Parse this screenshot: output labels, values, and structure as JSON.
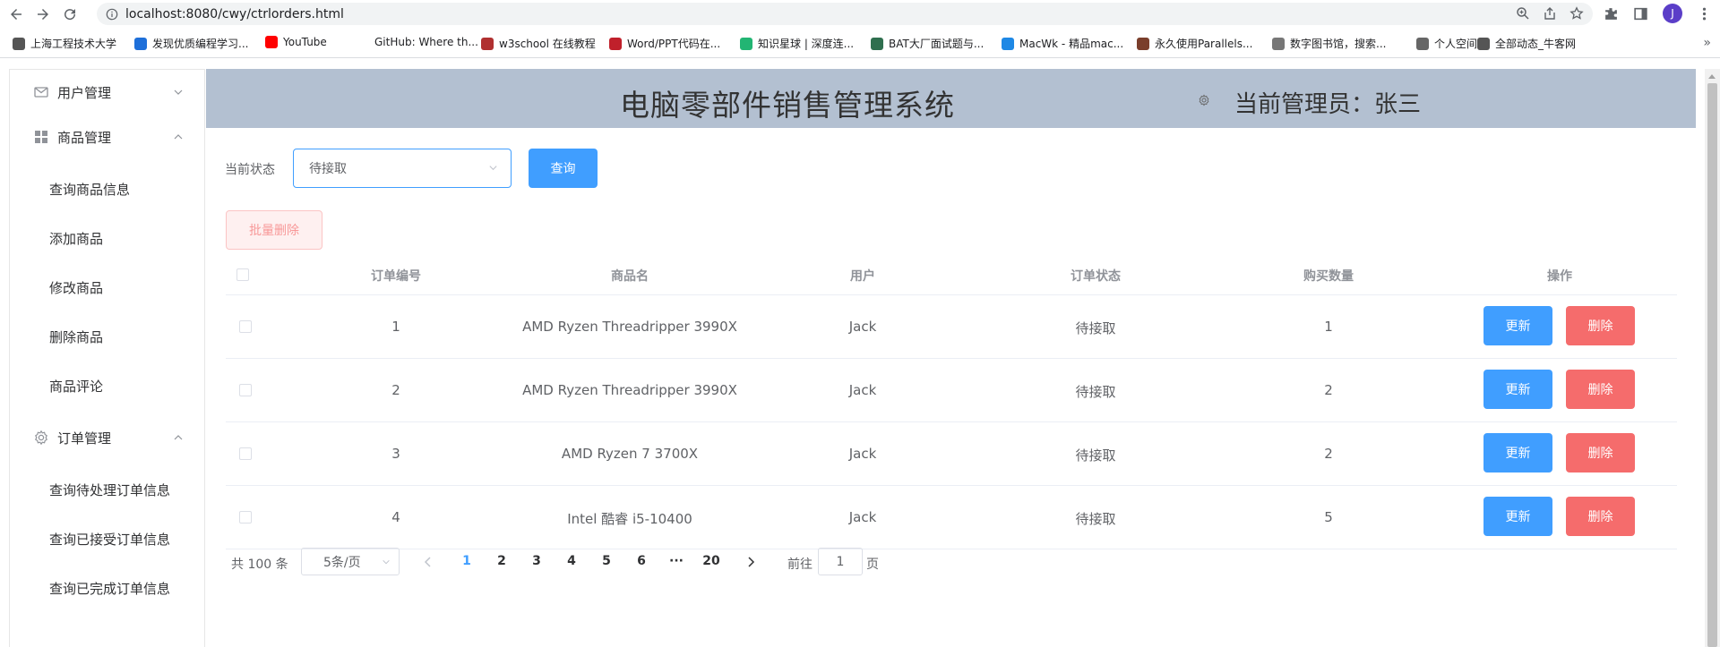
{
  "browser": {
    "url": "localhost:8080/cwy/ctrlorders.html",
    "avatar": "J",
    "bookmarks": [
      {
        "label": "上海工程技术大学",
        "color": "#555"
      },
      {
        "label": "发现优质编程学习...",
        "color": "#1e6fd9"
      },
      {
        "label": "YouTube",
        "color": "#ff0000"
      },
      {
        "label": "GitHub: Where th...",
        "color": "#ffffff"
      },
      {
        "label": "w3school 在线教程",
        "color": "#b03030"
      },
      {
        "label": "Word/PPT代码在...",
        "color": "#c0202b"
      },
      {
        "label": "知识星球 | 深度连...",
        "color": "#22b573"
      },
      {
        "label": "BAT大厂面试题与...",
        "color": "#2f6f4f"
      },
      {
        "label": "MacWk - 精品mac...",
        "color": "#1e88e5"
      },
      {
        "label": "永久使用Parallels...",
        "color": "#7a3e2b"
      },
      {
        "label": "数字图书馆，搜索...",
        "color": "#777"
      },
      {
        "label": "个人空间",
        "color": "#666"
      },
      {
        "label": "全部动态_牛客网",
        "color": "#555"
      }
    ]
  },
  "sidebar": {
    "groups": [
      {
        "label": "用户管理",
        "icon": "envelope-icon",
        "expanded": false
      },
      {
        "label": "商品管理",
        "icon": "grid-icon",
        "expanded": true,
        "items": [
          "查询商品信息",
          "添加商品",
          "修改商品",
          "删除商品",
          "商品评论"
        ]
      },
      {
        "label": "订单管理",
        "icon": "gear-icon",
        "expanded": true,
        "items": [
          "查询待处理订单信息",
          "查询已接受订单信息",
          "查询已完成订单信息"
        ]
      }
    ]
  },
  "header": {
    "title": "电脑零部件销售管理系统",
    "admin": "当前管理员：张三"
  },
  "filter": {
    "label": "当前状态",
    "selected": "待接取",
    "query_button": "查询",
    "batch_delete": "批量删除"
  },
  "table": {
    "columns": [
      "订单编号",
      "商品名",
      "用户",
      "订单状态",
      "购买数量",
      "操作"
    ],
    "rows": [
      {
        "id": "1",
        "product": "AMD Ryzen Threadripper 3990X",
        "user": "Jack",
        "status": "待接取",
        "qty": "1"
      },
      {
        "id": "2",
        "product": "AMD Ryzen Threadripper 3990X",
        "user": "Jack",
        "status": "待接取",
        "qty": "2"
      },
      {
        "id": "3",
        "product": "AMD Ryzen 7 3700X",
        "user": "Jack",
        "status": "待接取",
        "qty": "2"
      },
      {
        "id": "4",
        "product": "Intel 酷睿 i5-10400",
        "user": "Jack",
        "status": "待接取",
        "qty": "5"
      }
    ],
    "update_label": "更新",
    "delete_label": "删除"
  },
  "pagination": {
    "total": "共 100 条",
    "page_size": "5条/页",
    "pages": [
      "1",
      "2",
      "3",
      "4",
      "5",
      "6",
      "···",
      "20"
    ],
    "current": "1",
    "goto_label": "前往",
    "goto_value": "1",
    "page_unit": "页"
  },
  "colors": {
    "primary": "#409eff",
    "danger": "#f56c6c",
    "header_bg": "#b3c0d1"
  }
}
